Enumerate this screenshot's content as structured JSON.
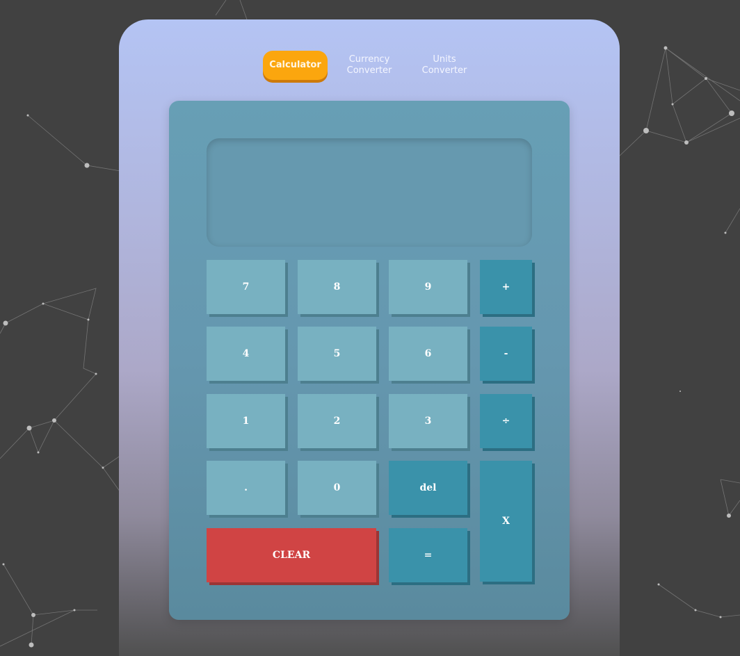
{
  "tabs": {
    "calculator": "Calculator",
    "currency_line1": "Currency",
    "currency_line2": "Converter",
    "units_line1": "Units",
    "units_line2": "Converter"
  },
  "display": {
    "value": ""
  },
  "keys": {
    "k7": "7",
    "k8": "8",
    "k9": "9",
    "plus": "+",
    "k4": "4",
    "k5": "5",
    "k6": "6",
    "minus": "-",
    "k1": "1",
    "k2": "2",
    "k3": "3",
    "divide": "÷",
    "dot": ".",
    "k0": "0",
    "del": "del",
    "multiply": "X",
    "clear": "CLEAR",
    "equals": "="
  },
  "colors": {
    "page_background": "#414141",
    "active_tab": "#fba60e",
    "number_key": "#78b1c1",
    "operator_key": "#3a92aa",
    "clear_key": "#d04444"
  }
}
